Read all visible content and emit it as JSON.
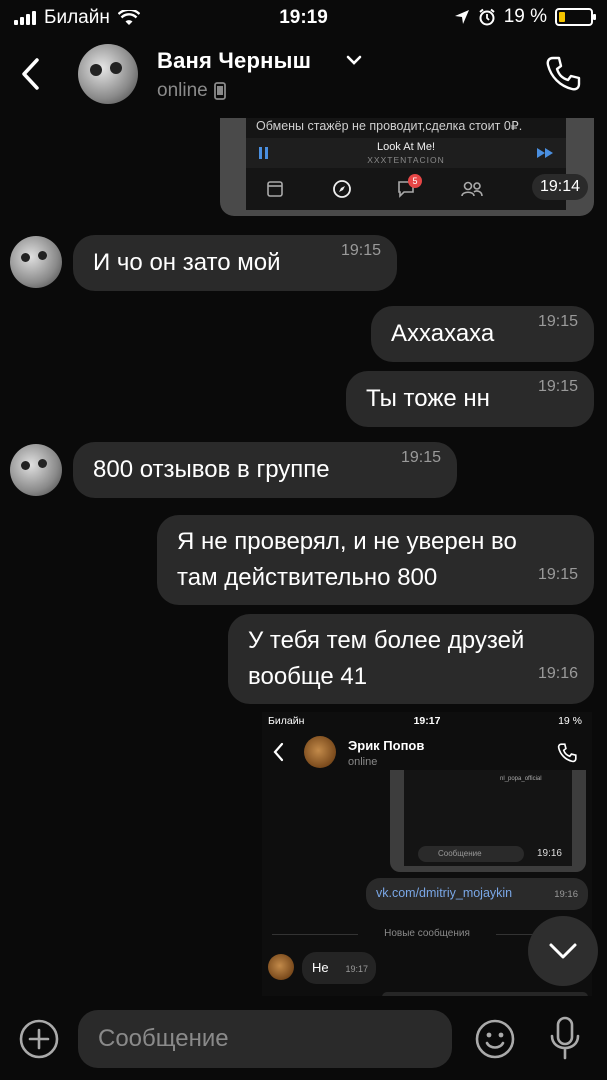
{
  "status_bar": {
    "carrier": "Билайн",
    "time": "19:19",
    "battery": "19 %",
    "battery_level": 0.19
  },
  "header": {
    "name": "Ваня Черныш",
    "status": "online"
  },
  "top_screenshot": {
    "text_line": "Обмены стажёр не проводит,сделка стоит 0₽.",
    "song": "Look At Me!",
    "artist": "XXXTENTACION",
    "badge": "5",
    "time": "19:14"
  },
  "messages": [
    {
      "side": "in",
      "text": "И чо он зато мой",
      "time": "19:15"
    },
    {
      "side": "out",
      "text": "Аххахаха",
      "time": "19:15"
    },
    {
      "side": "out",
      "text": "Ты тоже нн",
      "time": "19:15"
    },
    {
      "side": "in",
      "text": "800 отзывов в группе",
      "time": "19:15"
    },
    {
      "side": "out",
      "text": "Я не проверял, и не уверен во\nтам действительно 800",
      "time": "19:15"
    },
    {
      "side": "out",
      "text": "У тебя тем более друзей\nвообще 41",
      "time": "19:16"
    }
  ],
  "inner_screenshot": {
    "carrier": "Билайн",
    "time": "19:17",
    "battery": "19 %",
    "contact_name": "Эрик Попов",
    "status": "online",
    "img_caption": "nl_popa_official",
    "compose_placeholder": "Сообщение",
    "img_time": "19:16",
    "link": "vk.com/dmitriy_mojaykin",
    "link_time": "19:16",
    "new_messages": "Новые сообщения",
    "msg_text": "Не",
    "msg_time": "19:17"
  },
  "input": {
    "placeholder": "Сообщение"
  }
}
